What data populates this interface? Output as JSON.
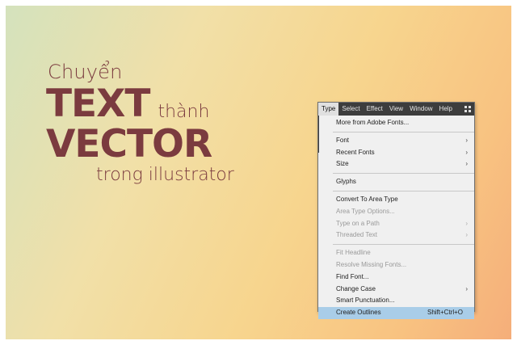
{
  "headline": {
    "line1": "Chuyển",
    "line2_big": "TEXT",
    "line2_small": "thành",
    "line3_big": "VECTOR",
    "line4": "trong illustrator"
  },
  "menubar": {
    "items": [
      "Type",
      "Select",
      "Effect",
      "View",
      "Window",
      "Help"
    ],
    "active": "Type",
    "workspace_icon": "workspace-switcher-icon"
  },
  "menu": {
    "items": [
      {
        "label": "More from Adobe Fonts...",
        "submenu": false,
        "disabled": false
      },
      {
        "label": "Font",
        "submenu": true,
        "disabled": false
      },
      {
        "label": "Recent Fonts",
        "submenu": true,
        "disabled": false
      },
      {
        "label": "Size",
        "submenu": true,
        "disabled": false
      },
      {
        "label": "Glyphs",
        "submenu": false,
        "disabled": false
      },
      {
        "label": "Convert To Area Type",
        "submenu": false,
        "disabled": false
      },
      {
        "label": "Area Type Options...",
        "submenu": false,
        "disabled": true
      },
      {
        "label": "Type on a Path",
        "submenu": true,
        "disabled": true
      },
      {
        "label": "Threaded Text",
        "submenu": true,
        "disabled": true
      },
      {
        "label": "Fit Headline",
        "submenu": false,
        "disabled": true
      },
      {
        "label": "Resolve Missing Fonts...",
        "submenu": false,
        "disabled": true
      },
      {
        "label": "Find Font...",
        "submenu": false,
        "disabled": false
      },
      {
        "label": "Change Case",
        "submenu": true,
        "disabled": false
      },
      {
        "label": "Smart Punctuation...",
        "submenu": false,
        "disabled": false
      },
      {
        "label": "Create Outlines",
        "submenu": false,
        "disabled": false,
        "highlighted": true,
        "shortcut": "Shift+Ctrl+O"
      }
    ]
  },
  "colors": {
    "headline": "#7b3b3f",
    "menubar": "#3d3d3d",
    "highlight": "#a9cde8"
  }
}
